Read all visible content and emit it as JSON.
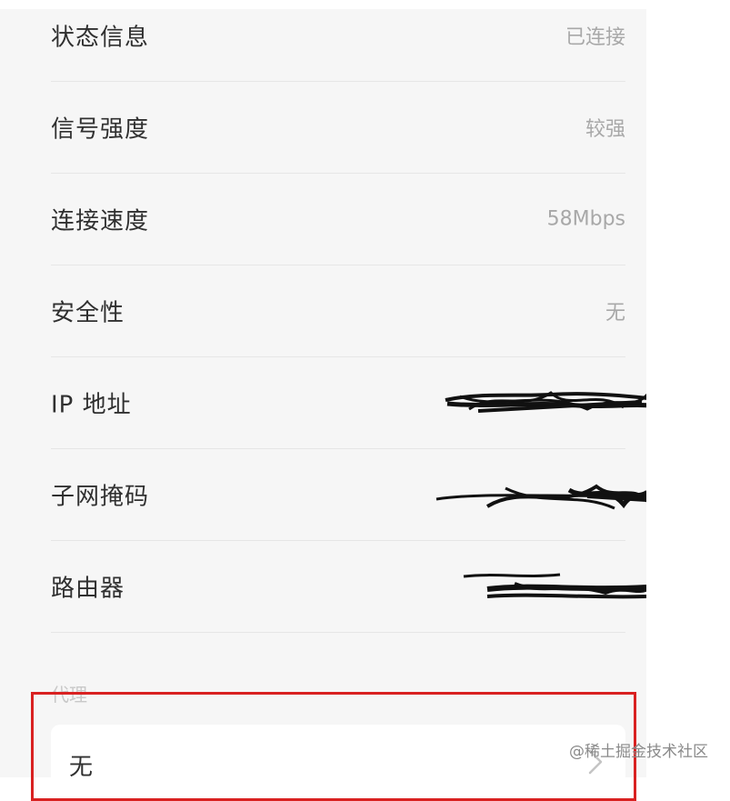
{
  "network_details": {
    "rows": [
      {
        "label": "状态信息",
        "value": "已连接"
      },
      {
        "label": "信号强度",
        "value": "较强"
      },
      {
        "label": "连接速度",
        "value": "58Mbps"
      },
      {
        "label": "安全性",
        "value": "无"
      },
      {
        "label": "IP 地址",
        "value": ""
      },
      {
        "label": "子网掩码",
        "value": ""
      },
      {
        "label": "路由器",
        "value": ""
      }
    ]
  },
  "proxy": {
    "section_label": "代理",
    "value": "无"
  },
  "watermark": "@稀土掘金技术社区",
  "colors": {
    "highlight": "#d92121",
    "background": "#f6f6f6"
  }
}
